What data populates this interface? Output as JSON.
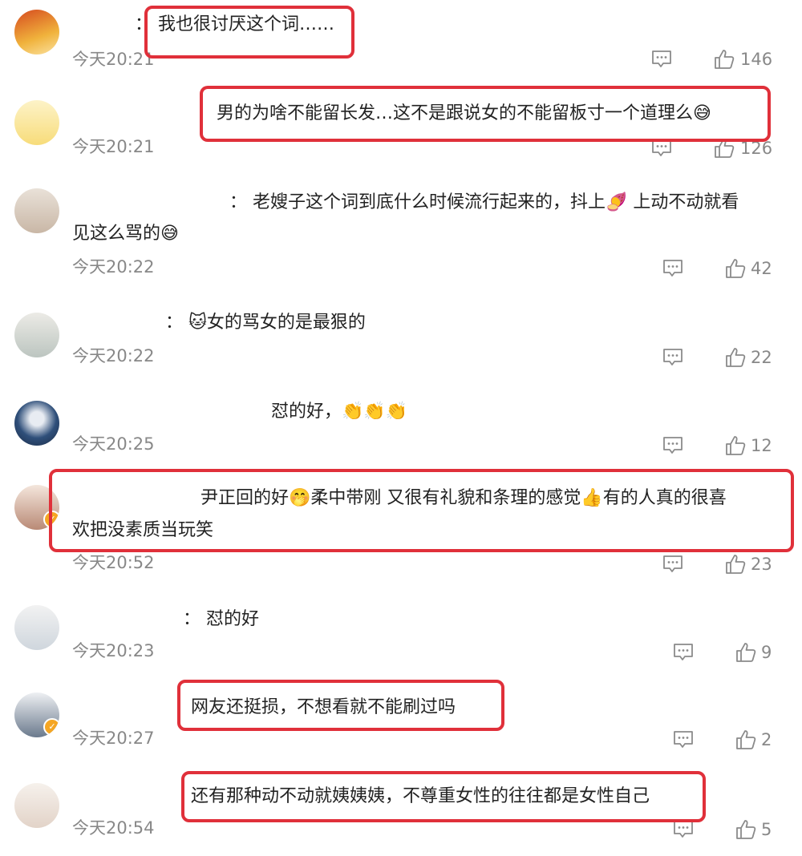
{
  "colors": {
    "highlight": "#e0303a",
    "muted": "#888888",
    "text": "#222222"
  },
  "comments": [
    {
      "text": "： 我也很讨厌这个词……",
      "time": "今天20:21",
      "likes": "146"
    },
    {
      "text": "男的为啥不能留长发…这不是跟说女的不能留板寸一个道理么😅",
      "time": "今天20:21",
      "likes": "126"
    },
    {
      "text_line1": "： 老嫂子这个词到底什么时候流行起来的，抖上🍠 上动不动就看",
      "text_line2": "见这么骂的😅",
      "time": "今天20:22",
      "likes": "42"
    },
    {
      "text": "： 🐱女的骂女的是最狠的",
      "time": "今天20:22",
      "likes": "22"
    },
    {
      "text": "怼的好，👏👏👏",
      "time": "今天20:25",
      "likes": "12"
    },
    {
      "text_line1": "尹正回的好🤭柔中带刚 又很有礼貌和条理的感觉👍有的人真的很喜",
      "text_line2": "欢把没素质当玩笑",
      "time": "今天20:52",
      "likes": "23"
    },
    {
      "text": "： 怼的好",
      "time": "今天20:23",
      "likes": "9"
    },
    {
      "text": "网友还挺损，不想看就不能刷过吗",
      "time": "今天20:27",
      "likes": "2"
    },
    {
      "text": "还有那种动不动就姨姨姨，不尊重女性的往往都是女性自己",
      "time": "今天20:54",
      "likes": "5"
    }
  ],
  "icons": {
    "reply": "comment-icon",
    "like": "thumbs-up-icon"
  }
}
